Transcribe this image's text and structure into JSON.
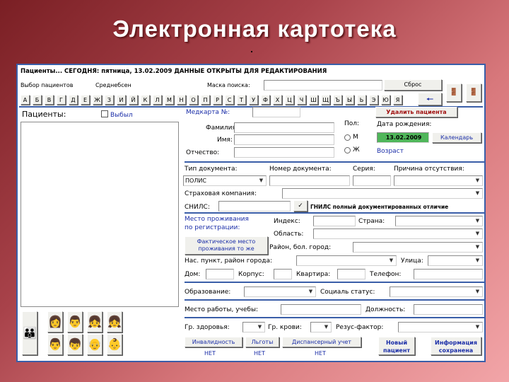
{
  "slide_title": "Электронная картотека",
  "window": {
    "status_bar": "Пациенты... СЕГОДНЯ: пятница, 13.02.2009 ДАННЫЕ ОТКРЫТЫ ДЛЯ РЕДАКТИРОВАНИЯ"
  },
  "toolbar": {
    "select_label": "Выбор пациентов",
    "select_value": "Среднебсен",
    "search_label": "Маска поиска:",
    "search_value": "",
    "reset_label": "Сброс",
    "alphabet": [
      "А",
      "Б",
      "В",
      "Г",
      "Д",
      "Е",
      "Ж",
      "З",
      "И",
      "Й",
      "К",
      "Л",
      "М",
      "Н",
      "О",
      "П",
      "Р",
      "С",
      "Т",
      "У",
      "Ф",
      "Х",
      "Ц",
      "Ч",
      "Ш",
      "Щ",
      "Ъ",
      "Ы",
      "Ь",
      "Э",
      "Ю",
      "Я"
    ],
    "back_icon": "arrow-left-icon",
    "icons": [
      "door-exit-icon",
      "door-enter-icon"
    ]
  },
  "left_panel": {
    "patients_label": "Пациенты:",
    "dropped_label": "Выбыл"
  },
  "card": {
    "medcard_label": "Медкарта №:",
    "delete_button": "Удалить пациента",
    "surname_label": "Фамилия:",
    "name_label": "Имя:",
    "patronymic_label": "Отчество:",
    "sex_label": "Пол:",
    "sex_m": "М",
    "sex_f": "Ж",
    "birth_label": "Дата рождения:",
    "birth_value": "13.02.2009",
    "calendar_button": "Календарь",
    "age_label": "Возраст",
    "doc_type_label": "Тип документа:",
    "doc_type_value": "ПОЛИС",
    "doc_number_label": "Номер документа:",
    "doc_series_label": "Серия:",
    "absence_label": "Причина отсутствия:",
    "insurer_label": "Страховая компания:",
    "snils_label": "СНИЛС:",
    "gnils_text": "ГНИЛС полный документированных отличие",
    "address_reg_label_1": "Место проживания",
    "address_reg_label_2": "по регистрации:",
    "index_label": "Индекс:",
    "country_label": "Страна:",
    "region_label": "Область:",
    "district_label": "Район, бол. город:",
    "actual_button_1": "Фактическое место",
    "actual_button_2": "проживания то же",
    "city_label": "Нас. пункт, район города:",
    "street_label": "Улица:",
    "house_label": "Дом:",
    "building_label": "Корпус:",
    "flat_label": "Квартира:",
    "phone_label": "Телефон:",
    "education_label": "Образование:",
    "social_label": "Социаль статус:",
    "work_label": "Место работы, учебы:",
    "position_label": "Должность:",
    "health_label": "Гр. здоровья:",
    "blood_label": "Гр. крови:",
    "rhesus_label": "Резус-фактор:"
  },
  "bottom_buttons": {
    "disability": "Инвалидность",
    "benefits": "Льготы",
    "dispensary": "Диспансерный учет",
    "disability_value": "НЕТ",
    "benefits_value": "НЕТ",
    "dispensary_value": "НЕТ",
    "new_patient_1": "Новый",
    "new_patient_2": "пациент",
    "info_1": "Информация",
    "info_2": "сохранена"
  },
  "figures": [
    "family-icon",
    "woman-icon",
    "man-icon",
    "girl-icon",
    "boy-icon",
    "man-black-icon",
    "man-blue-icon",
    "elder-icon",
    "child-icon"
  ]
}
